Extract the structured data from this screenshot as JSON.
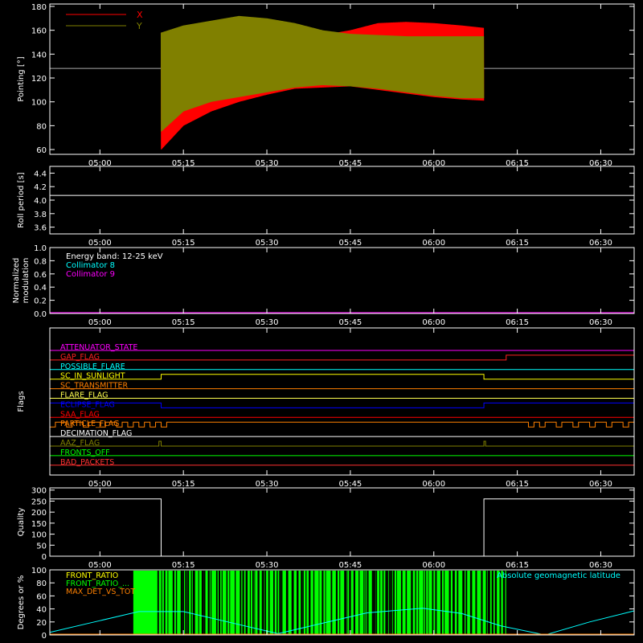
{
  "chart_data": [
    {
      "id": "pointing",
      "type": "line",
      "ylabel": "Pointing [°]",
      "ylim": [
        56,
        182
      ],
      "yticks": [
        60,
        80,
        100,
        120,
        140,
        160,
        180
      ],
      "xticks": [
        "05:00",
        "05:15",
        "05:30",
        "05:45",
        "06:00",
        "06:15",
        "06:30"
      ],
      "reference_line": 128,
      "data_start": "05:11",
      "data_end": "06:09",
      "series": [
        {
          "name": "X",
          "color": "#ff0000",
          "x": [
            "05:11",
            "05:15",
            "05:20",
            "05:25",
            "05:30",
            "05:35",
            "05:40",
            "05:45",
            "05:50",
            "05:55",
            "06:00",
            "06:05",
            "06:09"
          ],
          "max": [
            158,
            155,
            157,
            160,
            158,
            156,
            156,
            160,
            166,
            167,
            166,
            164,
            162
          ],
          "min": [
            60,
            80,
            92,
            100,
            106,
            111,
            112,
            113,
            110,
            107,
            104,
            102,
            101
          ]
        },
        {
          "name": "Y",
          "color": "#808000",
          "x": [
            "05:11",
            "05:15",
            "05:20",
            "05:25",
            "05:30",
            "05:35",
            "05:40",
            "05:45",
            "05:50",
            "05:55",
            "06:00",
            "06:05",
            "06:09"
          ],
          "max": [
            158,
            164,
            168,
            172,
            170,
            166,
            160,
            157,
            156,
            155,
            155,
            155,
            155
          ],
          "min": [
            75,
            92,
            100,
            104,
            108,
            112,
            114,
            113,
            111,
            108,
            105,
            103,
            103
          ]
        }
      ]
    },
    {
      "id": "roll",
      "type": "line",
      "ylabel": "Roll period [s]",
      "ylim": [
        3.5,
        4.5
      ],
      "yticks": [
        "3.6",
        "3.8",
        "4.0",
        "4.2",
        "4.4"
      ],
      "xticks": [
        "05:00",
        "05:15",
        "05:30",
        "05:45",
        "06:00",
        "06:15",
        "06:30"
      ],
      "series": [
        {
          "name": "",
          "color": "#ffffff",
          "x": [
            "04:51",
            "06:36"
          ],
          "y": [
            4.07,
            4.07
          ]
        }
      ]
    },
    {
      "id": "modulation",
      "type": "line",
      "ylabel": "Normalized\nmodulation",
      "ylim": [
        0,
        1
      ],
      "yticks": [
        "0.0",
        "0.2",
        "0.4",
        "0.6",
        "0.8",
        "1.0"
      ],
      "xticks": [
        "05:00",
        "05:15",
        "05:30",
        "05:45",
        "06:00",
        "06:15",
        "06:30"
      ],
      "legend_title": "Energy band: 12-25 keV",
      "series": [
        {
          "name": "Collimator 8",
          "color": "#00ffff",
          "x": [
            "04:51",
            "06:36"
          ],
          "y": [
            0,
            0
          ]
        },
        {
          "name": "Collimator 9",
          "color": "#ff00ff",
          "x": [
            "04:51",
            "06:36"
          ],
          "y": [
            0,
            0
          ]
        }
      ]
    },
    {
      "id": "flags",
      "type": "line",
      "ylabel": "Flags",
      "xticks": [
        "05:00",
        "05:15",
        "05:30",
        "05:45",
        "06:00",
        "06:15",
        "06:30"
      ],
      "series": [
        {
          "name": "ATTENUATOR_STATE",
          "color": "#ff00ff",
          "transitions": []
        },
        {
          "name": "GAP_FLAG",
          "color": "#ff2020",
          "transitions": [
            "06:13"
          ],
          "initial": 0
        },
        {
          "name": "POSSIBLE_FLARE",
          "color": "#00ffff",
          "transitions": []
        },
        {
          "name": "SC_IN_SUNLIGHT",
          "color": "#ffff00",
          "transitions": [
            "05:11",
            "06:09"
          ],
          "initial": 0
        },
        {
          "name": "SC_TRANSMITTER",
          "color": "#ff8000",
          "transitions": []
        },
        {
          "name": "FLARE_FLAG",
          "color": "#ffff50",
          "transitions": []
        },
        {
          "name": "ECLIPSE_FLAG",
          "color": "#0000ff",
          "transitions": [
            "05:11",
            "06:09"
          ],
          "initial": 1
        },
        {
          "name": "SAA_FLAG",
          "color": "#ff0000",
          "transitions": []
        },
        {
          "name": "PARTICLE_FLAG",
          "color": "#ff8000",
          "transitions": [
            "04:51",
            "04:52",
            "04:54",
            "04:55",
            "04:57",
            "04:58",
            "05:00",
            "05:01",
            "05:03",
            "05:04",
            "05:05",
            "05:06",
            "05:07",
            "05:08",
            "05:09",
            "05:10",
            "05:11",
            "05:12",
            "06:17",
            "06:18",
            "06:19",
            "06:20",
            "06:22",
            "06:23",
            "06:25",
            "06:26",
            "06:28",
            "06:29",
            "06:31",
            "06:32",
            "06:34",
            "06:35"
          ],
          "initial": 1
        },
        {
          "name": "DECIMATION_FLAG",
          "color": "#ffffff",
          "transitions": []
        },
        {
          "name": "AAZ_FLAG",
          "color": "#808000",
          "transitions": [
            "05:10.6",
            "05:11",
            "06:09",
            "06:09.3"
          ],
          "initial": 0
        },
        {
          "name": "FRONTS_OFF",
          "color": "#00ff00",
          "transitions": []
        },
        {
          "name": "BAD_PACKETS",
          "color": "#ff3030",
          "transitions": []
        }
      ]
    },
    {
      "id": "quality",
      "type": "line",
      "ylabel": "Quality",
      "ylim": [
        0,
        310
      ],
      "yticks": [
        0,
        50,
        100,
        150,
        200,
        250,
        300
      ],
      "xticks": [
        "05:00",
        "05:15",
        "05:30",
        "05:45",
        "06:00",
        "06:15",
        "06:30"
      ],
      "series": [
        {
          "name": "",
          "color": "#ffffff",
          "x": [
            "04:51",
            "05:11",
            "05:11",
            "06:09",
            "06:09",
            "06:36"
          ],
          "y": [
            260,
            260,
            0,
            0,
            260,
            260
          ]
        }
      ]
    },
    {
      "id": "geomagnetic",
      "type": "line",
      "ylabel": "Degrees or %",
      "ylim": [
        0,
        100
      ],
      "yticks": [
        0,
        20,
        40,
        60,
        80,
        100
      ],
      "legend_left": [
        "FRONT_RATIO",
        "FRONT_RATIO_...",
        "MAX_DET_VS_TOT"
      ],
      "legend_left_colors": [
        "#ffff00",
        "#00ff00",
        "#ff8000"
      ],
      "legend_right": "Absolute geomagnetic latitude",
      "legend_right_color": "#00ffff",
      "green_band": [
        "05:06",
        "06:13"
      ],
      "series": [
        {
          "name": "Absolute geomagnetic latitude",
          "color": "#00ffff",
          "x": [
            "04:51",
            "05:00",
            "05:07",
            "05:15",
            "05:23",
            "05:32",
            "05:40",
            "05:48",
            "05:58",
            "06:05",
            "06:12",
            "06:20",
            "06:28",
            "06:36"
          ],
          "y": [
            4,
            22,
            36,
            36,
            20,
            2,
            18,
            34,
            41,
            33,
            14,
            0,
            20,
            37
          ]
        }
      ]
    }
  ]
}
